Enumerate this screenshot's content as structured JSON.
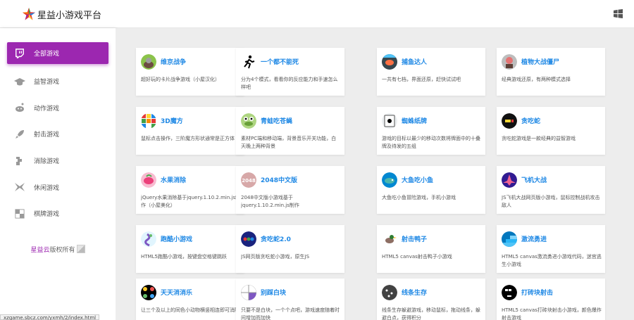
{
  "app": {
    "title": "星益小游戏平台",
    "status_url": "xzgame.sbcz.com/yxmh/2/index.html"
  },
  "sidebar": {
    "items": [
      {
        "label": "全部游戏",
        "icon": "twitch-icon",
        "active": true
      },
      {
        "label": "益智游戏",
        "icon": "graduation-cap-icon",
        "active": false
      },
      {
        "label": "动作游戏",
        "icon": "reddit-icon",
        "active": false
      },
      {
        "label": "射击游戏",
        "icon": "rocket-icon",
        "active": false
      },
      {
        "label": "消除游戏",
        "icon": "puzzle-icon",
        "active": false
      },
      {
        "label": "休闲游戏",
        "icon": "bow-tie-icon",
        "active": false
      },
      {
        "label": "棋牌游戏",
        "icon": "chessboard-icon",
        "active": false
      }
    ],
    "copyright_link": "星益云",
    "copyright_text": "版权所有"
  },
  "cards": [
    {
      "title": "维京战争",
      "desc": "超好玩的卡片战争游戏（小屋汉化）",
      "icon": "viking-icon"
    },
    {
      "title": "一个都不能死",
      "desc": "分为4个模式，看看你的反应能力和手速怎么样吧",
      "icon": "running-man-icon"
    },
    {
      "title": "捕鱼达人",
      "desc": "一共有七档，界面还原，赶快试试吧",
      "icon": "fish-icon"
    },
    {
      "title": "植物大战僵尸",
      "desc": "经典游戏还原，有两种模式选择",
      "icon": "zombie-icon"
    },
    {
      "title": "3D魔方",
      "desc": "鼠标点击操作，三阶魔方形状通常是正方体",
      "icon": "rubik-cube-icon"
    },
    {
      "title": "青蛙吃苍蝇",
      "desc": "素材PC端和移动端，背景音乐开关功能，白天晚上两种背景",
      "icon": "frog-icon"
    },
    {
      "title": "蜘蛛纸牌",
      "desc": "游戏的目标以最少的移动次数将牌面中的十叠牌及待发的五组",
      "icon": "spider-cards-icon"
    },
    {
      "title": "贪吃蛇",
      "desc": "贪吃蛇游戏是一款经典的益智游戏",
      "icon": "snake-icon"
    },
    {
      "title": "水果消除",
      "desc": "jQuery水果消除基于jquery.1.10.2.min.js制作（小屋美化）",
      "icon": "fruit-icon"
    },
    {
      "title": "2048中文版",
      "desc": "2048中文版小游戏基于jquery.1.10.2.min.js制作",
      "icon": "2048-icon",
      "icon_text": "2048"
    },
    {
      "title": "大鱼吃小鱼",
      "desc": "大鱼吃小鱼冒险游戏，手机小游戏",
      "icon": "big-fish-icon"
    },
    {
      "title": "飞机大战",
      "desc": "JS飞机大战网页版小游戏，鼠标控制战机攻击敌人",
      "icon": "plane-icon"
    },
    {
      "title": "跑酷小游戏",
      "desc": "HTML5跑酷小游戏，按键盘空格键跳跃",
      "icon": "parkour-icon"
    },
    {
      "title": "贪吃蛇2.0",
      "desc": "JS网页版贪吃蛇小游戏，原生JS",
      "icon": "dots-icon"
    },
    {
      "title": "射击鸭子",
      "desc": "HTML5 canvas射击鸭子小游戏",
      "icon": "duck-icon"
    },
    {
      "title": "激流勇进",
      "desc": "HTML5 canvas激流勇进小游戏代码，迷宫逃生小游戏",
      "icon": "stairs-icon"
    },
    {
      "title": "天天消消乐",
      "desc": "让三个及以上的同色小动物横竖相连即可消除",
      "icon": "match3-icon"
    },
    {
      "title": "别踩白块",
      "desc": "只要不是白块，一个个点吧，游戏速度随着时间增加而加快",
      "icon": "white-tile-icon"
    },
    {
      "title": "线条生存",
      "desc": "线条生存躲避游戏，移动鼠标，拖动线条，躲避白点，获得积分",
      "icon": "line-survive-icon"
    },
    {
      "title": "打砖块射击",
      "desc": "HTML5 canvas打砖块射击小游戏，颜色爆炸射击游戏",
      "icon": "brick-icon"
    }
  ]
}
